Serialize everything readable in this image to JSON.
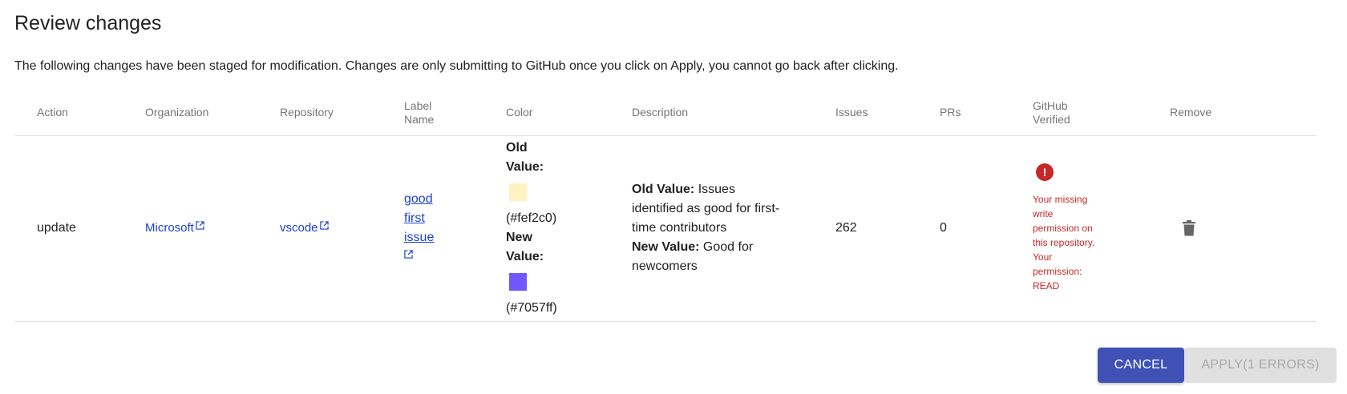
{
  "header": {
    "title": "Review changes",
    "description": "The following changes have been staged for modification. Changes are only submitting to GitHub once you click on Apply, you cannot go back after clicking."
  },
  "table": {
    "columns": [
      "Action",
      "Organization",
      "Repository",
      "Label Name",
      "Color",
      "Description",
      "Issues",
      "PRs",
      "GitHub Verified",
      "Remove"
    ],
    "row": {
      "action": "update",
      "organization": "Microsoft",
      "repository": "vscode",
      "label_name_words": [
        "good",
        "first",
        "issue"
      ],
      "color": {
        "old_label": "Old Value:",
        "old_hex": "(#fef2c0)",
        "old_swatch": "#fef2c0",
        "new_label": "New Value:",
        "new_hex": "(#7057ff)",
        "new_swatch": "#7057ff"
      },
      "description": {
        "old_label": "Old Value:",
        "old_text": " Issues identified as good for first-time contributors",
        "new_label": "New Value:",
        "new_text": " Good for newcomers"
      },
      "issues": "262",
      "prs": "0",
      "github_verified": {
        "icon": "error-icon",
        "icon_glyph": "!",
        "message": "Your missing write permission on this repository. Your permission: READ",
        "status_color": "#c62828"
      },
      "remove_icon": "trash-icon"
    }
  },
  "actions": {
    "cancel_label": "CANCEL",
    "apply_label": "APPLY(1 ERRORS)"
  },
  "colors": {
    "primary": "#3f51b5",
    "link": "#1a3fd6",
    "error": "#c62828"
  }
}
